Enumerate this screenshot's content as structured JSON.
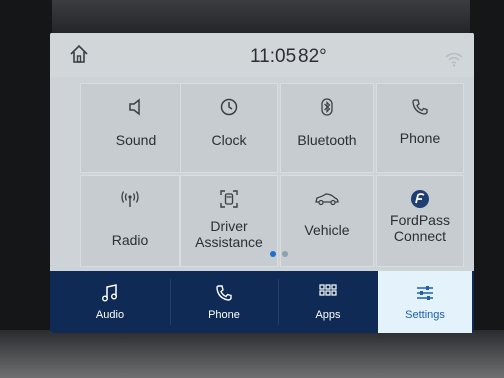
{
  "status_bar": {
    "time": "11:05",
    "temperature": "82°"
  },
  "tiles": [
    {
      "label": "Sound",
      "icon": "speaker-icon"
    },
    {
      "label": "Clock",
      "icon": "clock-icon"
    },
    {
      "label": "Bluetooth",
      "icon": "bluetooth-icon"
    },
    {
      "label": "Phone",
      "icon": "phone-icon"
    },
    {
      "label": "Radio",
      "icon": "antenna-icon"
    },
    {
      "label": "Driver\nAssistance",
      "label_line1": "Driver",
      "label_line2": "Assistance",
      "icon": "driver-assist-icon"
    },
    {
      "label": "Vehicle",
      "icon": "car-icon"
    },
    {
      "label": "FordPass\nConnect",
      "label_line1": "FordPass",
      "label_line2": "Connect",
      "icon": "fordpass-icon"
    }
  ],
  "pager": {
    "pages": 2,
    "current": 1
  },
  "nav": [
    {
      "label": "Audio",
      "icon": "music-note-icon"
    },
    {
      "label": "Phone",
      "icon": "phone-icon"
    },
    {
      "label": "Apps",
      "icon": "apps-grid-icon"
    },
    {
      "label": "Settings",
      "icon": "sliders-icon",
      "selected": true
    }
  ],
  "colors": {
    "screen_bg": "#cdd3d6",
    "nav_bg": "#0f2a55",
    "nav_selected_bg": "#e3f2fb",
    "accent": "#1d5fb1",
    "text": "#2b2f33"
  }
}
